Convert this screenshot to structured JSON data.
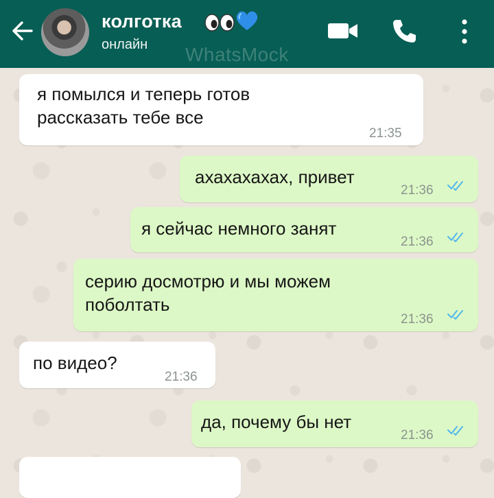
{
  "header": {
    "contact_name": "колготка",
    "status": "онлайн",
    "watermark": "WhatsMock",
    "background_color": "#075e54"
  },
  "icons": {
    "back": "back-arrow-icon",
    "video": "video-call-icon",
    "phone": "phone-call-icon",
    "menu": "more-options-icon",
    "eyes": "eyes-emoji-icon",
    "heart": "blue-heart-emoji-icon",
    "read_receipt": "double-check-icon"
  },
  "colors": {
    "incoming_bubble": "#ffffff",
    "outgoing_bubble": "#dcf8c6",
    "read_tick": "#4fb6ec",
    "chat_background": "#ece5dd"
  },
  "messages": [
    {
      "direction": "in",
      "text": "я помылся и теперь готов\nрассказать тебе все",
      "time": "21:35"
    },
    {
      "direction": "out",
      "text": "ахахахахах, привет",
      "time": "21:36",
      "read": true
    },
    {
      "direction": "out",
      "text": "я сейчас немного занят",
      "time": "21:36",
      "read": true
    },
    {
      "direction": "out",
      "text": "серию досмотрю и мы можем\nпоболтать",
      "time": "21:36",
      "read": true
    },
    {
      "direction": "in",
      "text": "по видео?",
      "time": "21:36"
    },
    {
      "direction": "out",
      "text": "да, почему бы нет",
      "time": "21:36",
      "read": true
    }
  ]
}
